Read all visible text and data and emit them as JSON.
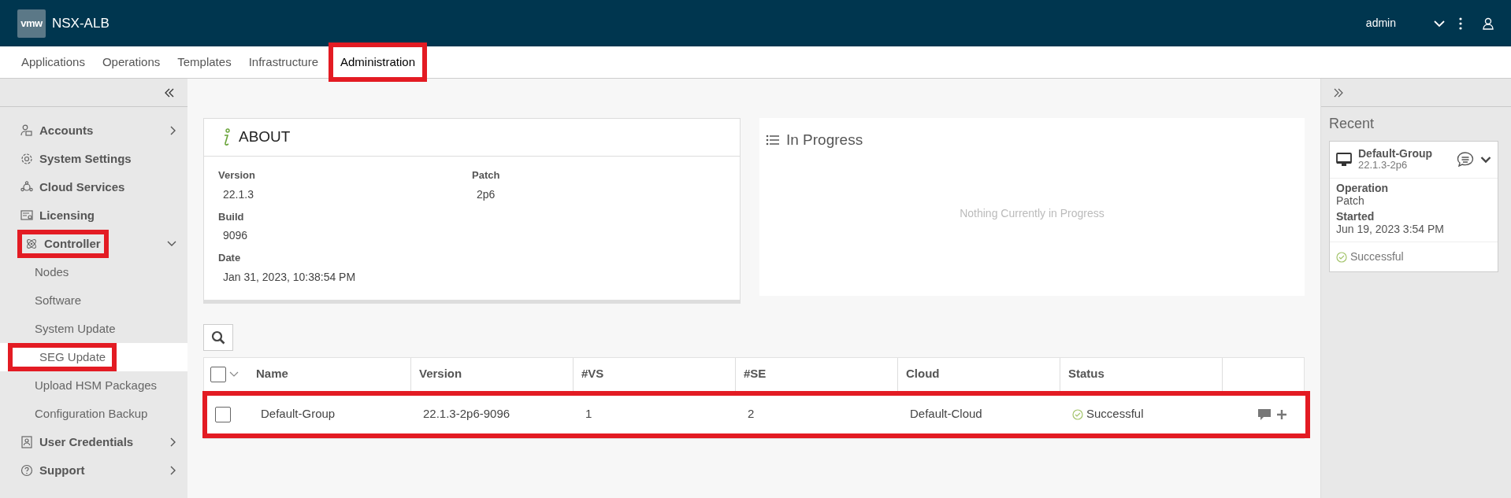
{
  "header": {
    "logo": "vmw",
    "app_name": "NSX-ALB",
    "user": "admin"
  },
  "nav_tabs": [
    {
      "label": "Applications",
      "selected": false,
      "highlighted": false
    },
    {
      "label": "Operations",
      "selected": false,
      "highlighted": false
    },
    {
      "label": "Templates",
      "selected": false,
      "highlighted": false
    },
    {
      "label": "Infrastructure",
      "selected": false,
      "highlighted": false
    },
    {
      "label": "Administration",
      "selected": true,
      "highlighted": true
    }
  ],
  "sidebar": {
    "items": [
      {
        "label": "Accounts",
        "expanded": false,
        "highlighted": false
      },
      {
        "label": "System Settings",
        "highlighted": false
      },
      {
        "label": "Cloud Services",
        "highlighted": false
      },
      {
        "label": "Licensing",
        "highlighted": false
      },
      {
        "label": "Controller",
        "expanded": true,
        "highlighted": true,
        "children": [
          {
            "label": "Nodes",
            "selected": false,
            "highlighted": false
          },
          {
            "label": "Software",
            "selected": false,
            "highlighted": false
          },
          {
            "label": "System Update",
            "selected": false,
            "highlighted": false
          },
          {
            "label": "SEG Update",
            "selected": true,
            "highlighted": true
          },
          {
            "label": "Upload HSM Packages",
            "selected": false,
            "highlighted": false
          },
          {
            "label": "Configuration Backup",
            "selected": false,
            "highlighted": false
          }
        ]
      },
      {
        "label": "User Credentials",
        "expanded": false,
        "highlighted": false
      },
      {
        "label": "Support",
        "expanded": false,
        "highlighted": false
      }
    ]
  },
  "about": {
    "title": "ABOUT",
    "rows": [
      [
        {
          "label": "Version",
          "value": "22.1.3"
        },
        {
          "label": "Patch",
          "value": "2p6"
        }
      ],
      [
        {
          "label": "Build",
          "value": "9096"
        }
      ],
      [
        {
          "label": "Date",
          "value": "Jan 31, 2023, 10:38:54 PM"
        }
      ]
    ]
  },
  "in_progress": {
    "title": "In Progress",
    "empty_message": "Nothing Currently in Progress"
  },
  "table": {
    "select_all_checked": false,
    "columns": [
      "Name",
      "Version",
      "#VS",
      "#SE",
      "Cloud",
      "Status"
    ],
    "rows": [
      {
        "checked": false,
        "highlighted": true,
        "cells": [
          "Default-Group",
          "22.1.3-2p6-9096",
          "1",
          "2",
          "Default-Cloud"
        ],
        "status": "Successful"
      }
    ]
  },
  "recent": {
    "title": "Recent",
    "items": [
      {
        "name": "Default-Group",
        "version": "22.1.3-2p6",
        "fields": [
          {
            "label": "Operation",
            "value": "Patch"
          },
          {
            "label": "Started",
            "value": "Jun 19, 2023 3:54 PM"
          }
        ],
        "status": "Successful"
      }
    ]
  }
}
